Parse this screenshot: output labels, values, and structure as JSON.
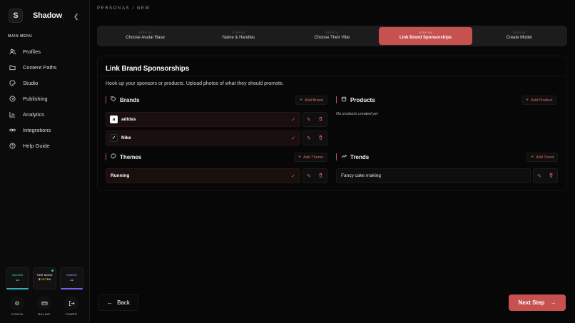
{
  "app": {
    "name": "Shadow",
    "logo_glyph": "S"
  },
  "sidebar": {
    "menu_title": "MAIN MENU",
    "items": [
      {
        "label": "Profiles",
        "icon": "users-icon"
      },
      {
        "label": "Content Paths",
        "icon": "folder-icon"
      },
      {
        "label": "Studio",
        "icon": "palette-icon"
      },
      {
        "label": "Publishing",
        "icon": "send-icon"
      },
      {
        "label": "Analytics",
        "icon": "chart-icon"
      },
      {
        "label": "Integrations",
        "icon": "link-icon"
      },
      {
        "label": "Help Guide",
        "icon": "help-icon"
      }
    ],
    "stats": {
      "images": {
        "label": "IMAGES",
        "value": "--",
        "color": "#2bb3c0"
      },
      "tier": {
        "label": "TIER MODE",
        "value": "ULTRA",
        "color": "#d9b64a"
      },
      "videos": {
        "label": "VIDEOS",
        "value": "--",
        "color": "#7a5cf0"
      }
    },
    "utils": [
      {
        "label": "CONFIG",
        "icon": "gear-icon"
      },
      {
        "label": "BILLING",
        "icon": "card-icon"
      },
      {
        "label": "POWER",
        "icon": "logout-icon"
      }
    ]
  },
  "breadcrumb": "PERSONAS / NEW",
  "steps": [
    {
      "num": "STEP 01",
      "label": "Choose Avatar Base"
    },
    {
      "num": "STEP 02",
      "label": "Name & Handles"
    },
    {
      "num": "STEP 03",
      "label": "Choose Their Vibe"
    },
    {
      "num": "STEP 04",
      "label": "Link Brand Sponsorships",
      "active": true
    },
    {
      "num": "STEP 05",
      "label": "Create Model"
    }
  ],
  "panel": {
    "title": "Link Brand Sponsorships",
    "description": "Hook up your sponsors or products. Upload photos of what they should promote."
  },
  "brands": {
    "title": "Brands",
    "add_label": "Add Brand",
    "items": [
      {
        "name": "adidas",
        "logo": "a",
        "selected": true
      },
      {
        "name": "Nike",
        "logo": "✓",
        "selected": true
      }
    ]
  },
  "products": {
    "title": "Products",
    "add_label": "Add Product",
    "empty_text": "No products created yet"
  },
  "themes": {
    "title": "Themes",
    "add_label": "Add Theme",
    "items": [
      {
        "name": "Running",
        "selected": true
      }
    ]
  },
  "trends": {
    "title": "Trends",
    "add_label": "Add Trend",
    "items": [
      {
        "name": "Fancy cake making",
        "selected": false
      }
    ]
  },
  "nav": {
    "back_label": "Back",
    "next_label": "Next Step"
  },
  "colors": {
    "accent": "#c7514f",
    "background": "#070707"
  }
}
